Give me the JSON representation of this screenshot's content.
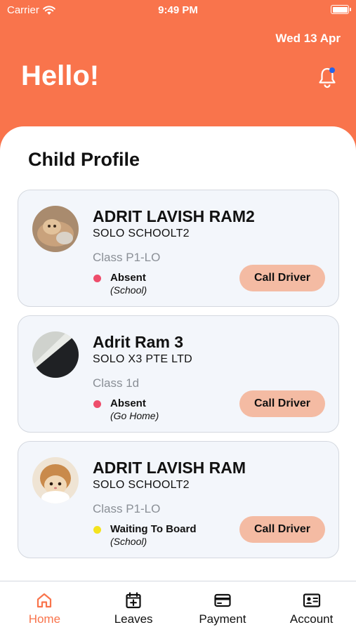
{
  "status_bar": {
    "carrier": "Carrier",
    "time": "9:49 PM"
  },
  "header": {
    "date": "Wed 13 Apr",
    "greeting": "Hello!"
  },
  "section_title": "Child Profile",
  "children": [
    {
      "name": "ADRIT LAVISH RAM2",
      "school": "SOLO SCHOOLT2",
      "class": "Class P1-LO",
      "status": "Absent",
      "status_detail": "(School)",
      "status_color": "#EE4D6B",
      "action": "Call Driver"
    },
    {
      "name": "Adrit Ram 3",
      "school": "SOLO X3 PTE LTD",
      "class": "Class 1d",
      "status": "Absent",
      "status_detail": "(Go Home)",
      "status_color": "#EE4D6B",
      "action": "Call Driver"
    },
    {
      "name": "ADRIT LAVISH RAM",
      "school": "SOLO SCHOOLT2",
      "class": "Class P1-LO",
      "status": "Waiting To Board",
      "status_detail": "(School)",
      "status_color": "#F4E31E",
      "action": "Call Driver"
    }
  ],
  "tabs": [
    {
      "label": "Home",
      "icon": "home-icon",
      "active": true
    },
    {
      "label": "Leaves",
      "icon": "calendar-plus-icon"
    },
    {
      "label": "Payment",
      "icon": "card-icon"
    },
    {
      "label": "Account",
      "icon": "id-card-icon"
    }
  ],
  "colors": {
    "accent": "#F9744C",
    "card_bg": "#F3F6FB",
    "button_bg": "#F4BBA3",
    "notification_dot": "#2563EB"
  }
}
